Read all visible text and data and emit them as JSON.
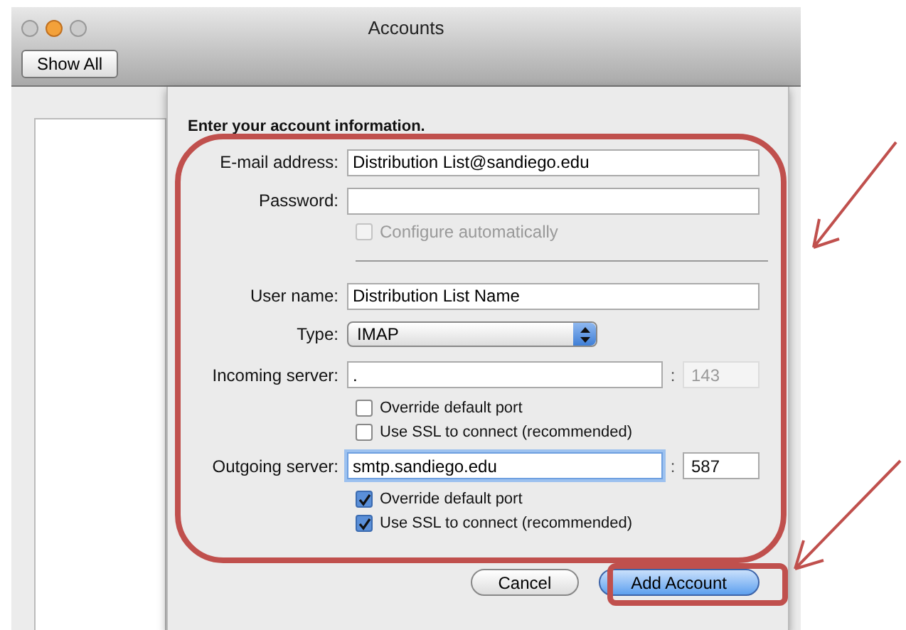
{
  "window": {
    "title": "Accounts"
  },
  "toolbar": {
    "show_all": "Show All"
  },
  "sheet": {
    "heading": "Enter your account information.",
    "rows": [
      {
        "kind": "text",
        "label": "E-mail address:",
        "value": "Distribution List@sandiego.edu",
        "focused": false
      },
      {
        "kind": "text",
        "label": "Password:",
        "value": "",
        "focused": false
      },
      {
        "kind": "checkbox",
        "label": "Configure automatically",
        "checked": false,
        "disabled": true
      },
      {
        "kind": "divider"
      },
      {
        "kind": "text",
        "label": "User name:",
        "value": "Distribution List Name",
        "focused": false
      },
      {
        "kind": "select",
        "label": "Type:",
        "value": "IMAP"
      },
      {
        "kind": "server",
        "label": "Incoming server:",
        "value": ".",
        "separator": ":",
        "port": "143",
        "port_disabled": true,
        "focused": false
      },
      {
        "kind": "checkbox",
        "label": "Override default port",
        "checked": false,
        "disabled": false
      },
      {
        "kind": "checkbox",
        "label": "Use SSL to connect (recommended)",
        "checked": false,
        "disabled": false
      },
      {
        "kind": "server",
        "label": "Outgoing server:",
        "value": "smtp.sandiego.edu",
        "separator": ":",
        "port": "587",
        "port_disabled": false,
        "focused": true
      },
      {
        "kind": "checkbox",
        "label": "Override default port",
        "checked": true,
        "disabled": false
      },
      {
        "kind": "checkbox",
        "label": "Use SSL to connect (recommended)",
        "checked": true,
        "disabled": false
      }
    ],
    "buttons": [
      {
        "label": "Cancel",
        "default": false
      },
      {
        "label": "Add Account",
        "default": true
      }
    ]
  }
}
